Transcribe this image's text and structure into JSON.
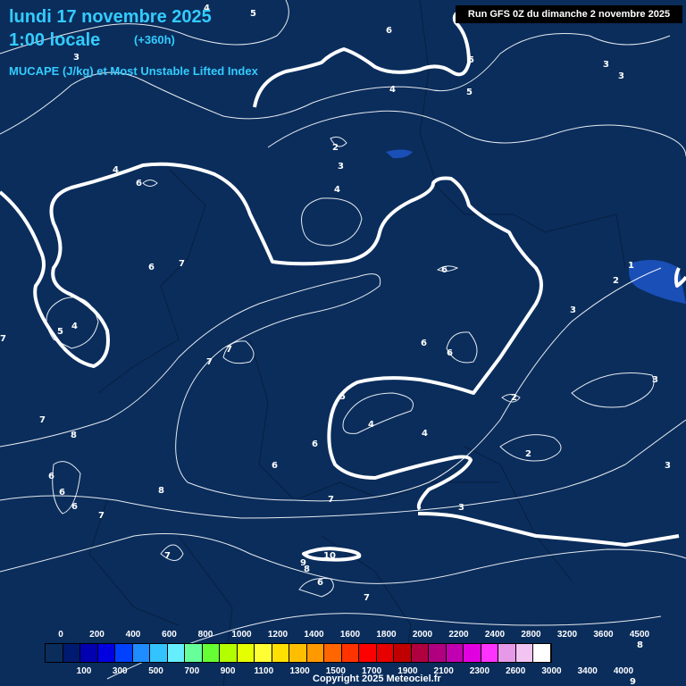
{
  "header": {
    "date": "lundi 17 novembre 2025",
    "time": "1:00 locale",
    "lead": "(+360h)",
    "parameter": "MUCAPE (J/kg) et Most Unstable Lifted Index",
    "run": "Run GFS 0Z du dimanche 2 novembre 2025"
  },
  "legend": {
    "top_ticks": [
      "0",
      "200",
      "400",
      "600",
      "800",
      "1000",
      "1200",
      "1400",
      "1600",
      "1800",
      "2000",
      "2200",
      "2400",
      "2800",
      "3200",
      "3600",
      "4500"
    ],
    "bottom_ticks": [
      "100",
      "300",
      "500",
      "700",
      "900",
      "1100",
      "1300",
      "1500",
      "1700",
      "1900",
      "2100",
      "2300",
      "2600",
      "3000",
      "3400",
      "4000"
    ],
    "colors": [
      "#0a2d5c",
      "#001a70",
      "#0000b0",
      "#0000e0",
      "#0040ff",
      "#1f8cff",
      "#33c3ff",
      "#66eeff",
      "#66ff99",
      "#66ff33",
      "#b3ff00",
      "#e6ff00",
      "#ffff33",
      "#ffe000",
      "#ffbf00",
      "#ff9900",
      "#ff6600",
      "#ff3300",
      "#ff0000",
      "#e60000",
      "#c00000",
      "#b00040",
      "#b00080",
      "#c000b0",
      "#e000e0",
      "#ff33ff",
      "#e699e6",
      "#f2c4f2",
      "#ffffff"
    ]
  },
  "contour_labels": [
    "4",
    "5",
    "6",
    "3",
    "5",
    "5",
    "3",
    "3",
    "4",
    "2",
    "3",
    "4",
    "6",
    "4",
    "6",
    "7",
    "6",
    "2",
    "1",
    "3",
    "7",
    "7",
    "6",
    "6",
    "5",
    "4",
    "4",
    "2",
    "3",
    "2",
    "3",
    "7",
    "8",
    "6",
    "6",
    "7",
    "8",
    "7",
    "6",
    "3",
    "9",
    "8",
    "10",
    "6",
    "7",
    "5",
    "4",
    "7",
    "7",
    "6",
    "6",
    "8",
    "9"
  ],
  "copyright": "Copyright 2025 Meteociel.fr"
}
